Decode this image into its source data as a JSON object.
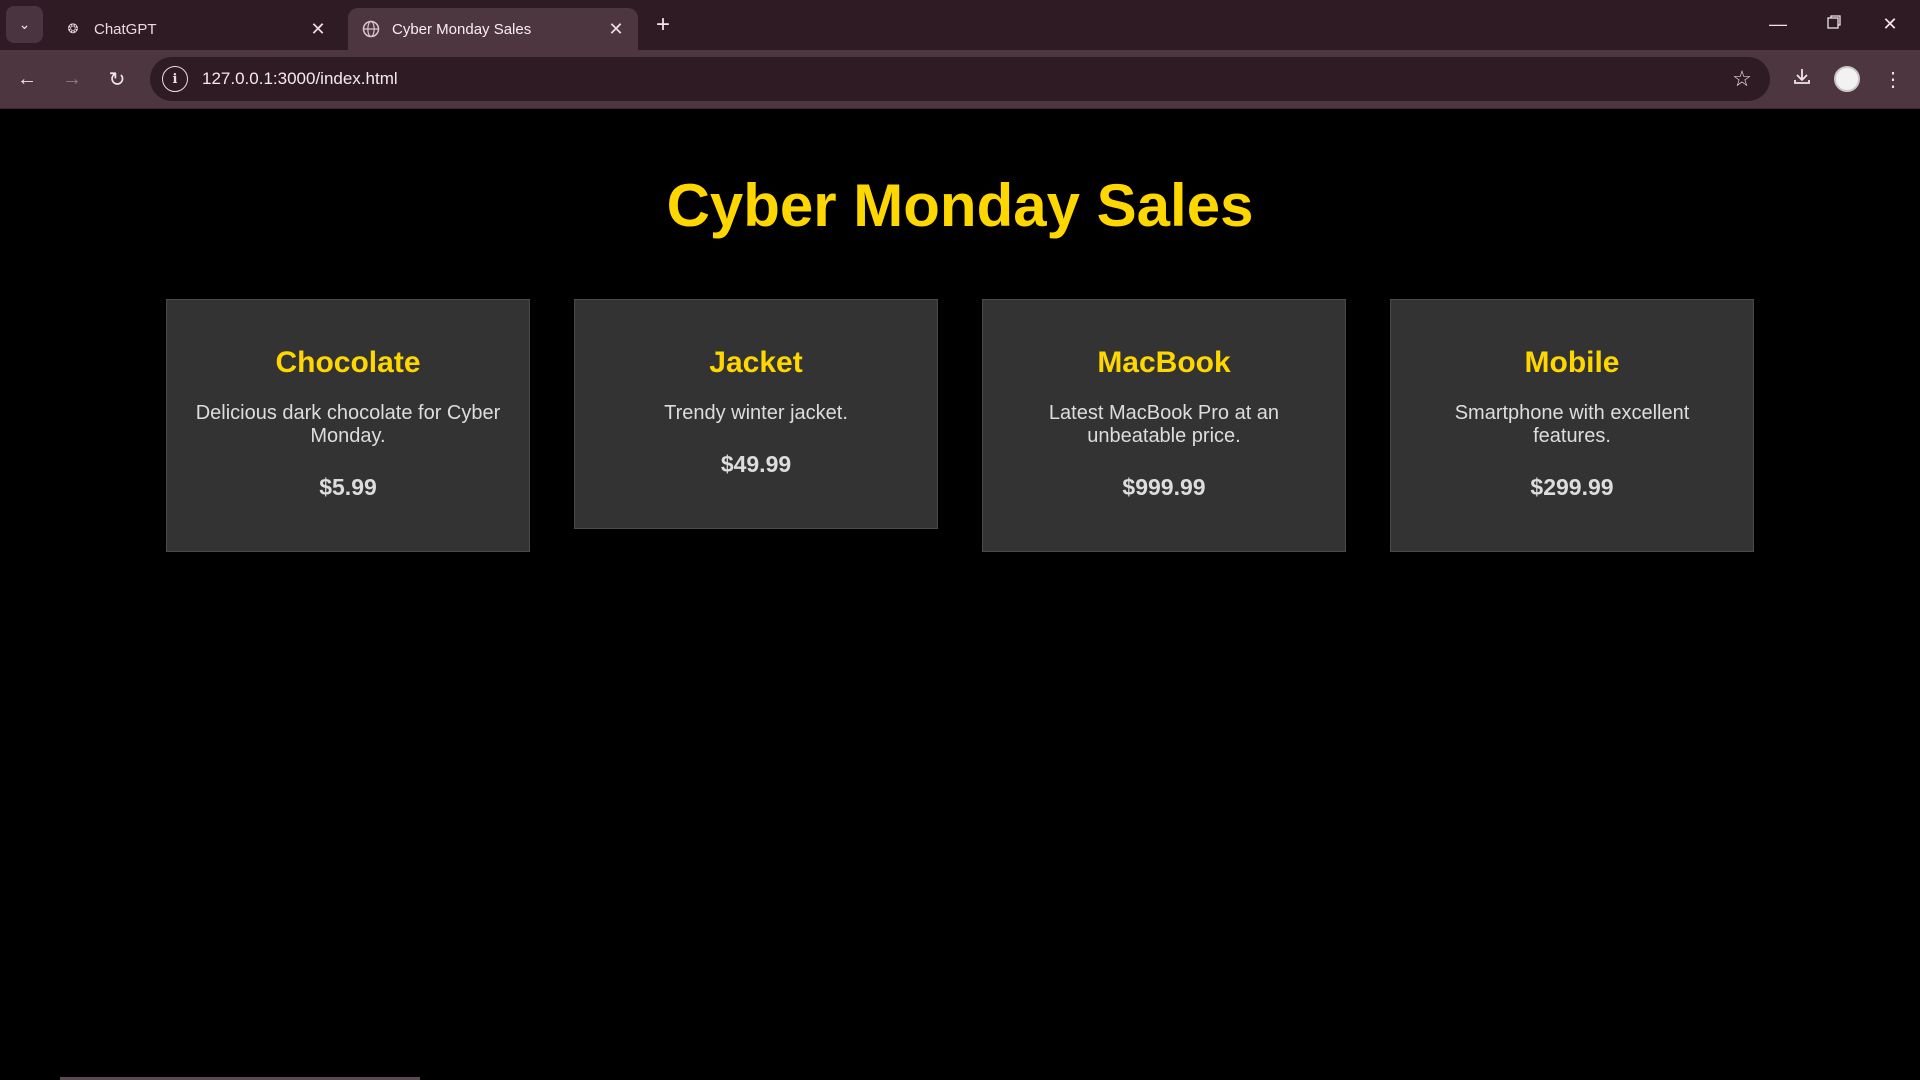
{
  "browser": {
    "tabs": [
      {
        "title": "ChatGPT",
        "icon": "chatgpt-icon",
        "active": false
      },
      {
        "title": "Cyber Monday Sales",
        "icon": "globe-icon",
        "active": true
      }
    ],
    "url": "127.0.0.1:3000/index.html"
  },
  "page": {
    "title": "Cyber Monday Sales",
    "colors": {
      "accent": "#ffd700",
      "card_bg": "#333333",
      "background": "#000000"
    },
    "products": [
      {
        "name": "Chocolate",
        "description": "Delicious dark chocolate for Cyber Monday.",
        "price": "$5.99"
      },
      {
        "name": "Jacket",
        "description": "Trendy winter jacket.",
        "price": "$49.99"
      },
      {
        "name": "MacBook",
        "description": "Latest MacBook Pro at an unbeatable price.",
        "price": "$999.99"
      },
      {
        "name": "Mobile",
        "description": "Smartphone with excellent features.",
        "price": "$299.99"
      }
    ]
  }
}
